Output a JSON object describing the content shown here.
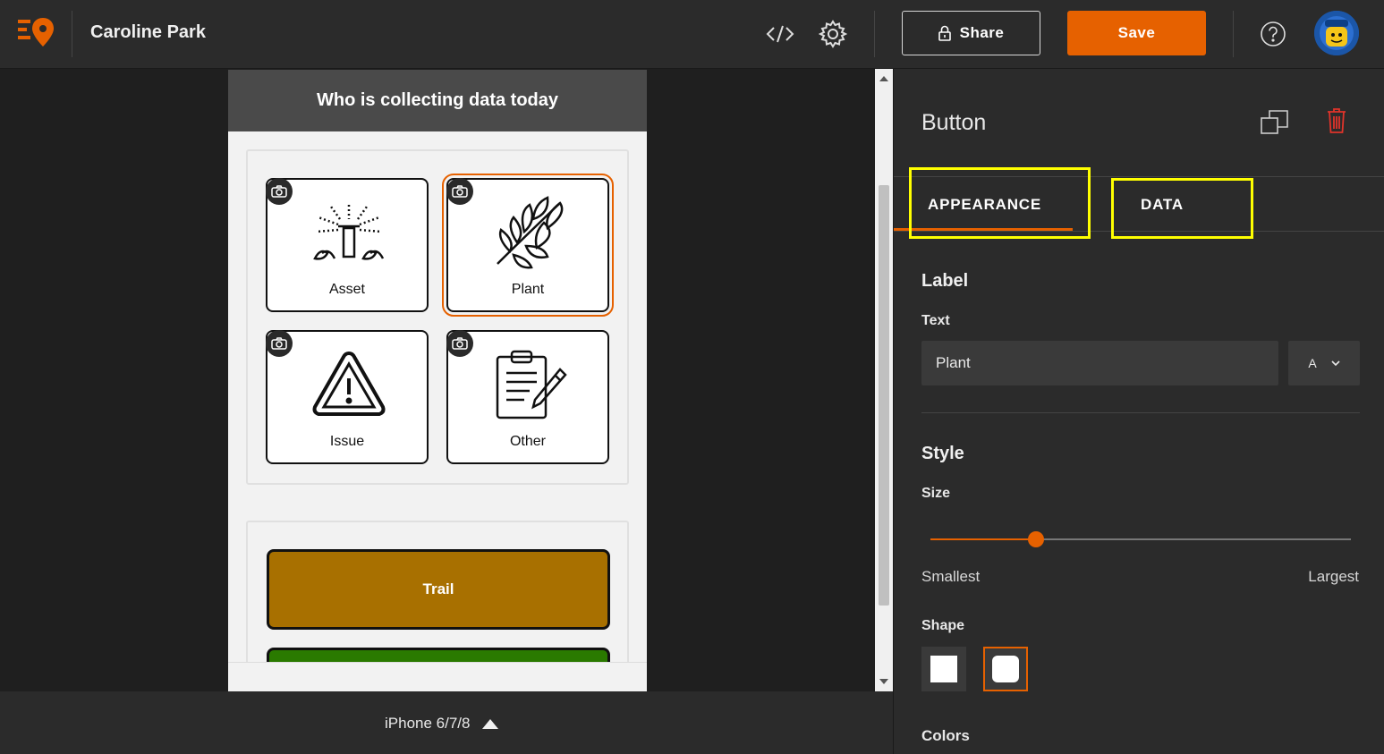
{
  "header": {
    "title": "Caroline Park",
    "share_label": "Share",
    "save_label": "Save"
  },
  "phone": {
    "header_title": "Who is collecting data today",
    "tiles": [
      {
        "label": "Asset",
        "icon": "sprinkler-icon"
      },
      {
        "label": "Plant",
        "icon": "leaf-branch-icon"
      },
      {
        "label": "Issue",
        "icon": "warning-triangle-icon"
      },
      {
        "label": "Other",
        "icon": "clipboard-pencil-icon"
      }
    ],
    "trail_label": "Trail",
    "colors": {
      "trail": "#a87000",
      "green": "#2a7a00"
    }
  },
  "device": {
    "label": "iPhone 6/7/8"
  },
  "panel": {
    "title": "Button",
    "tabs": [
      "APPEARANCE",
      "DATA"
    ],
    "label_section": "Label",
    "text_field_label": "Text",
    "text_value": "Plant",
    "font_select_value": "A",
    "style_section": "Style",
    "size_label": "Size",
    "size_min_label": "Smallest",
    "size_max_label": "Largest",
    "size_value": 0.25,
    "shape_label": "Shape",
    "colors_label": "Colors"
  },
  "accent_color": "#e66100",
  "highlight_color": "#ffff00"
}
